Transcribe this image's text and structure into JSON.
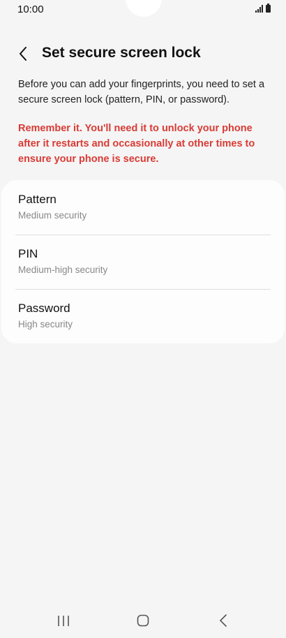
{
  "status_bar": {
    "time": "10:00"
  },
  "header": {
    "title": "Set secure screen lock"
  },
  "description": "Before you can add your fingerprints, you need to set a secure screen lock (pattern, PIN, or password).",
  "warning": "Remember it. You'll need it to unlock your phone after it restarts and occasionally at other times to ensure your phone is secure.",
  "options": [
    {
      "title": "Pattern",
      "subtitle": "Medium security"
    },
    {
      "title": "PIN",
      "subtitle": "Medium-high security"
    },
    {
      "title": "Password",
      "subtitle": "High security"
    }
  ],
  "colors": {
    "warning": "#d93b35",
    "background": "#f5f5f5",
    "card": "#fdfdfd"
  },
  "icons": {
    "back": "chevron-left-icon",
    "recents": "recent-apps-icon",
    "home": "home-icon",
    "nav_back": "back-icon"
  }
}
